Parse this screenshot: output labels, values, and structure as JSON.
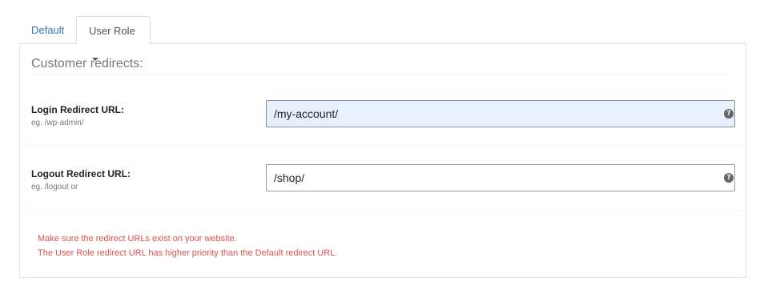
{
  "tabs": [
    {
      "label": "Default"
    },
    {
      "label": "User Role"
    }
  ],
  "section": {
    "title": "Customer redirects:"
  },
  "login": {
    "label": "Login Redirect URL:",
    "hint": "eg. /wp-admin/",
    "value": "/my-account/",
    "help_icon": "question-circle-icon"
  },
  "logout": {
    "label": "Logout Redirect URL:",
    "hint": "eg. /logout or",
    "value": "/shop/",
    "help_icon": "question-circle-icon"
  },
  "notice": {
    "line1": "Make sure the redirect URLs exist on your website.",
    "line2": "The User Role redirect URL has higher priority than the Default redirect URL."
  },
  "colors": {
    "link": "#337ab7",
    "warning": "#d9534f",
    "active_input_bg": "#e8f0fe"
  }
}
